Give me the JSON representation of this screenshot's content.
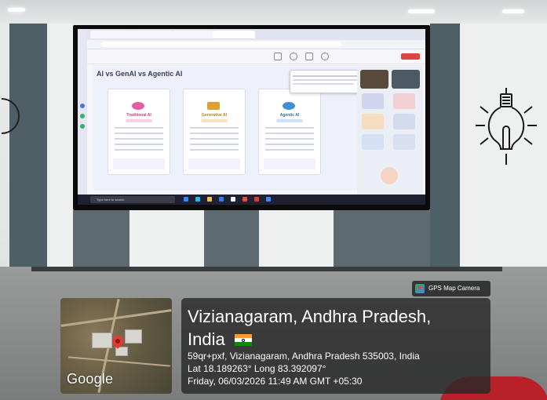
{
  "photo": {
    "description_free": true
  },
  "tv_screen": {
    "slide_title": "AI vs GenAI vs Agentic AI",
    "cards": [
      {
        "title": "Traditional AI",
        "color": "#e35ea0"
      },
      {
        "title": "Generative AI",
        "color": "#e0a030"
      },
      {
        "title": "Agentic AI",
        "color": "#3f8fd6"
      }
    ],
    "search_placeholder": "Type here to search"
  },
  "gps_badge": {
    "label": "GPS Map Camera"
  },
  "map": {
    "logo": "Google"
  },
  "location": {
    "line1": "Vizianagaram, Andhra Pradesh,",
    "line2": "India",
    "address": "59qr+pxf, Vizianagaram, Andhra Pradesh 535003, India",
    "coordinates": "Lat 18.189263° Long 83.392097°",
    "datetime": "Friday, 06/03/2026 11:49 AM GMT +05:30"
  },
  "colors": {
    "flag_saffron": "#ff9933",
    "flag_white": "#ffffff",
    "flag_green": "#138808",
    "pin": "#e53935"
  }
}
